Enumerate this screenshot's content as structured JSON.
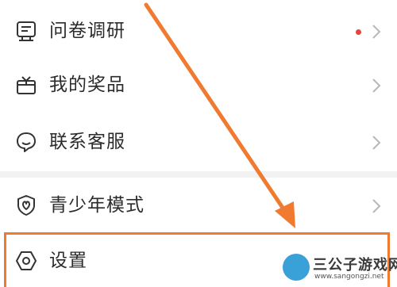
{
  "menu": {
    "items": [
      {
        "label": "问卷调研",
        "icon": "survey-icon",
        "badge_dot": true
      },
      {
        "label": "我的奖品",
        "icon": "gift-icon",
        "badge_dot": false
      },
      {
        "label": "联系客服",
        "icon": "customer-service-icon",
        "badge_dot": false
      },
      {
        "label": "青少年模式",
        "icon": "youth-mode-shield-icon",
        "badge_dot": false
      },
      {
        "label": "设置",
        "icon": "settings-hexagon-icon",
        "badge_dot": false
      }
    ]
  },
  "annotation": {
    "arrow_color": "#f07a30",
    "highlight_color": "#f07a30",
    "target": "设置"
  },
  "watermark": {
    "title": "三公子游戏网",
    "url": "www.sangongzi.net"
  }
}
